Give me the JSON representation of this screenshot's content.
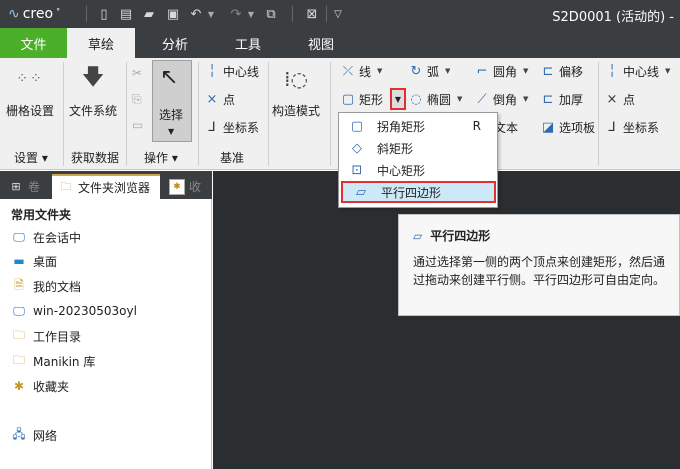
{
  "titlebar": {
    "logo": "creo",
    "window_title": "S2D0001 (活动的) -"
  },
  "tabs": [
    {
      "label": "文件"
    },
    {
      "label": "草绘"
    },
    {
      "label": "分析"
    },
    {
      "label": "工具"
    },
    {
      "label": "视图"
    }
  ],
  "ribbon": {
    "grid_settings": "栅格设置",
    "file_system": "文件系统",
    "select": "选择",
    "construct_mode": "构造模式",
    "centerline": "中心线",
    "point": "点",
    "csys": "坐标系",
    "line": "线",
    "rectangle": "矩形",
    "arc": "弧",
    "ellipse": "椭圆",
    "fillet": "圆角",
    "chamfer": "倒角",
    "text": "文本",
    "offset": "偏移",
    "thicken": "加厚",
    "palette": "选项板",
    "centerline2": "中心线",
    "point2": "点",
    "csys2": "坐标系",
    "groups": {
      "settings": "设置",
      "get_data": "获取数据",
      "operations": "操作",
      "datum": "基准"
    }
  },
  "rect_menu": {
    "items": [
      {
        "label": "拐角矩形",
        "shortcut": "R"
      },
      {
        "label": "斜矩形"
      },
      {
        "label": "中心矩形"
      },
      {
        "label": "平行四边形"
      }
    ]
  },
  "tooltip": {
    "title": "平行四边形",
    "body": "通过选择第一侧的两个顶点来创建矩形，然后通过拖动来创建平行侧。平行四边形可自由定向。"
  },
  "panel": {
    "tab_browser": "文件夹浏览器",
    "favorites_header": "常用文件夹",
    "items": [
      {
        "label": "在会话中"
      },
      {
        "label": "桌面"
      },
      {
        "label": "我的文档"
      },
      {
        "label": "win-20230503oyl"
      },
      {
        "label": "工作目录"
      },
      {
        "label": "Manikin 库"
      },
      {
        "label": "收藏夹"
      },
      {
        "label": "网络"
      }
    ]
  },
  "colors": {
    "file_tab": "#4caf2a",
    "highlight_border": "#e03030",
    "highlight_fill": "#cde8f6",
    "graphics_bg": "#2b2e31"
  }
}
